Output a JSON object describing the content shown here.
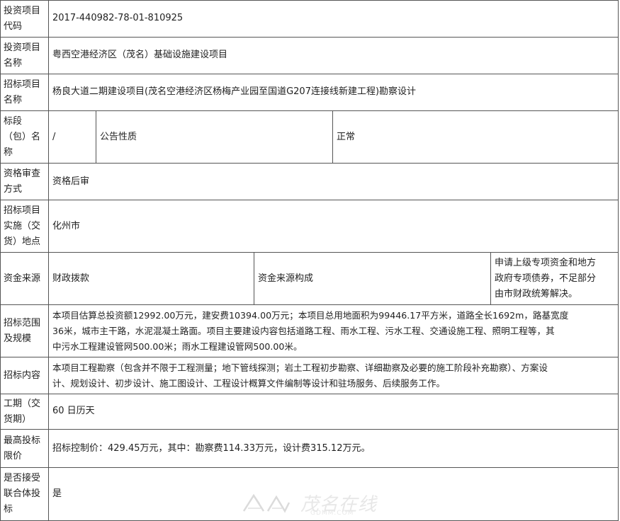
{
  "rows": {
    "project_code": {
      "label": "投资项目代码",
      "value": "2017-440982-78-01-810925"
    },
    "project_name": {
      "label": "投资项目名称",
      "value": "粤西空港经济区（茂名）基础设施建设项目"
    },
    "tender_name": {
      "label": "招标项目名称",
      "value": "杨良大道二期建设项目(茂名空港经济区杨梅产业园至国道G207连接线新建工程)勘察设计"
    },
    "lot": {
      "label": "标段（包）名称",
      "value": "/",
      "mid_label": "公告性质",
      "mid_value": "正常"
    },
    "qualification": {
      "label": "资格审查方式",
      "value": "资格后审"
    },
    "location": {
      "label": "招标项目实施（交货）地点",
      "value": "化州市"
    },
    "funding": {
      "label": "资金来源",
      "value": "财政拨款",
      "mid_label": "资金来源构成",
      "mid_value": "申请上级专项资金和地方政府专项债券，不足部分由市财政统筹解决。"
    },
    "scope": {
      "label": "招标范围及规模",
      "value": "本项目估算总投资额12992.00万元，建安费10394.00万元；本项目总用地面积为99446.17平方米，道路全长1692m，路基宽度36米，城市主干路，水泥混凝土路面。项目主要建设内容包括道路工程、雨水工程、污水工程、交通设施工程、照明工程等，其中污水工程建设管网500.00米；雨水工程建设管网500.00米。"
    },
    "content": {
      "label": "招标内容",
      "value": "本项目工程勘察（包含并不限于工程测量；地下管线探测；岩土工程初步勘察、详细勘察及必要的施工阶段补充勘察）、方案设计、规划设计、初步设计、施工图设计、工程设计概算文件编制等设计和驻场服务、后续服务工作。"
    },
    "period": {
      "label": "工期（交货期）",
      "value": "60 日历天"
    },
    "max_price": {
      "label": "最高投标限价",
      "value": "招标控制价：429.45万元，其中：勘察费114.33万元，设计费315.12万元。"
    },
    "consortium": {
      "label": "是否接受联合体投标",
      "value": "是"
    }
  },
  "label_lines": {
    "project_code": [
      "投资项目",
      "代码"
    ],
    "project_name": [
      "投资项目",
      "名称"
    ],
    "tender_name": [
      "招标项目",
      "名称"
    ],
    "lot": [
      "标段",
      "（包）名",
      "称"
    ],
    "qualification": [
      "资格审查",
      "方式"
    ],
    "location": [
      "招标项目",
      "实施（交",
      "货）地点"
    ],
    "scope": [
      "招标范围",
      "及规模"
    ],
    "period": [
      "工期（交",
      "货期）"
    ],
    "max_price": [
      "最高投标",
      "限价"
    ],
    "consortium": [
      "是否接受",
      "联合体投",
      "标"
    ]
  },
  "value_lines": {
    "funding_mid": [
      "申请上级专项资金和地方",
      "政府专项债券，不足部分",
      "由市财政统筹解决。"
    ],
    "scope": [
      "本项目估算总投资额12992.00万元，建安费10394.00万元；本项目总用地面积为99446.17平方米，道路全长1692m，路基宽度",
      "36米，城市主干路，水泥混凝土路面。项目主要建设内容包括道路工程、雨水工程、污水工程、交通设施工程、照明工程等，其",
      "中污水工程建设管网500.00米；雨水工程建设管网500.00米。"
    ],
    "content": [
      "本项目工程勘察（包含并不限于工程测量；地下管线探测；岩土工程初步勘察、详细勘察及必要的施工阶段补充勘察）、方案设",
      "计、规划设计、初步设计、施工图设计、工程设计概算文件编制等设计和驻场服务、后续服务工作。"
    ]
  },
  "watermark": {
    "text": "茂名在线",
    "url": "GDMM.COM"
  }
}
